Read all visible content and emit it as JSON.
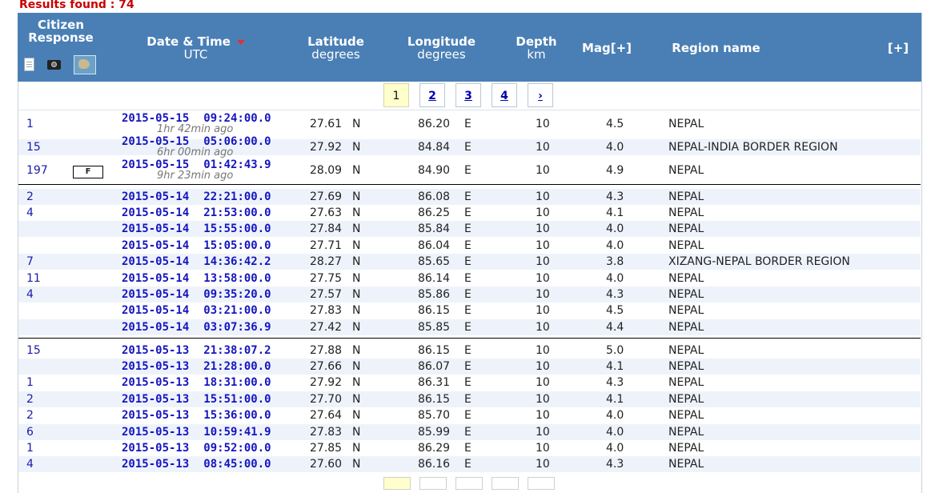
{
  "results_label": "Results found : 74",
  "header": {
    "citizen": "Citizen\nResponse",
    "date_title": "Date & Time",
    "date_sub": "UTC",
    "lat_title": "Latitude",
    "lat_sub": "degrees",
    "lon_title": "Longitude",
    "lon_sub": "degrees",
    "depth_title": "Depth",
    "depth_sub": "km",
    "mag": "Mag[+]",
    "region": "Region name",
    "expand": "[+]"
  },
  "pager": [
    "1",
    "2",
    "3",
    "4",
    "›"
  ],
  "rows": [
    {
      "cit": "1",
      "date": "2015-05-15",
      "time": "09:24:00.0",
      "ago": "1hr 42min ago",
      "lat": "27.61",
      "latd": "N",
      "lon": "86.20",
      "lond": "E",
      "depth": "10",
      "mag": "4.5",
      "region": "NEPAL"
    },
    {
      "cit": "15",
      "date": "2015-05-15",
      "time": "05:06:00.0",
      "ago": "6hr 00min ago",
      "lat": "27.92",
      "latd": "N",
      "lon": "84.84",
      "lond": "E",
      "depth": "10",
      "mag": "4.0",
      "region": "NEPAL-INDIA BORDER REGION"
    },
    {
      "cit": "197",
      "flag": "F",
      "date": "2015-05-15",
      "time": "01:42:43.9",
      "ago": "9hr 23min ago",
      "lat": "28.09",
      "latd": "N",
      "lon": "84.90",
      "lond": "E",
      "depth": "10",
      "mag": "4.9",
      "region": "NEPAL"
    },
    {
      "cit": "2",
      "date": "2015-05-14",
      "time": "22:21:00.0",
      "lat": "27.69",
      "latd": "N",
      "lon": "86.08",
      "lond": "E",
      "depth": "10",
      "mag": "4.3",
      "region": "NEPAL"
    },
    {
      "cit": "4",
      "date": "2015-05-14",
      "time": "21:53:00.0",
      "lat": "27.63",
      "latd": "N",
      "lon": "86.25",
      "lond": "E",
      "depth": "10",
      "mag": "4.1",
      "region": "NEPAL"
    },
    {
      "cit": "",
      "date": "2015-05-14",
      "time": "15:55:00.0",
      "lat": "27.84",
      "latd": "N",
      "lon": "85.84",
      "lond": "E",
      "depth": "10",
      "mag": "4.0",
      "region": "NEPAL"
    },
    {
      "cit": "",
      "date": "2015-05-14",
      "time": "15:05:00.0",
      "lat": "27.71",
      "latd": "N",
      "lon": "86.04",
      "lond": "E",
      "depth": "10",
      "mag": "4.0",
      "region": "NEPAL"
    },
    {
      "cit": "7",
      "date": "2015-05-14",
      "time": "14:36:42.2",
      "lat": "28.27",
      "latd": "N",
      "lon": "85.65",
      "lond": "E",
      "depth": "10",
      "mag": "3.8",
      "region": "XIZANG-NEPAL BORDER REGION"
    },
    {
      "cit": "11",
      "date": "2015-05-14",
      "time": "13:58:00.0",
      "lat": "27.75",
      "latd": "N",
      "lon": "86.14",
      "lond": "E",
      "depth": "10",
      "mag": "4.0",
      "region": "NEPAL"
    },
    {
      "cit": "4",
      "date": "2015-05-14",
      "time": "09:35:20.0",
      "lat": "27.57",
      "latd": "N",
      "lon": "85.86",
      "lond": "E",
      "depth": "10",
      "mag": "4.3",
      "region": "NEPAL"
    },
    {
      "cit": "",
      "date": "2015-05-14",
      "time": "03:21:00.0",
      "lat": "27.83",
      "latd": "N",
      "lon": "86.15",
      "lond": "E",
      "depth": "10",
      "mag": "4.5",
      "region": "NEPAL"
    },
    {
      "cit": "",
      "date": "2015-05-14",
      "time": "03:07:36.9",
      "lat": "27.42",
      "latd": "N",
      "lon": "85.85",
      "lond": "E",
      "depth": "10",
      "mag": "4.4",
      "region": "NEPAL"
    },
    {
      "cit": "15",
      "date": "2015-05-13",
      "time": "21:38:07.2",
      "lat": "27.88",
      "latd": "N",
      "lon": "86.15",
      "lond": "E",
      "depth": "10",
      "mag": "5.0",
      "region": "NEPAL"
    },
    {
      "cit": "",
      "date": "2015-05-13",
      "time": "21:28:00.0",
      "lat": "27.66",
      "latd": "N",
      "lon": "86.07",
      "lond": "E",
      "depth": "10",
      "mag": "4.1",
      "region": "NEPAL"
    },
    {
      "cit": "1",
      "date": "2015-05-13",
      "time": "18:31:00.0",
      "lat": "27.92",
      "latd": "N",
      "lon": "86.31",
      "lond": "E",
      "depth": "10",
      "mag": "4.3",
      "region": "NEPAL"
    },
    {
      "cit": "2",
      "date": "2015-05-13",
      "time": "15:51:00.0",
      "lat": "27.70",
      "latd": "N",
      "lon": "86.15",
      "lond": "E",
      "depth": "10",
      "mag": "4.1",
      "region": "NEPAL"
    },
    {
      "cit": "2",
      "date": "2015-05-13",
      "time": "15:36:00.0",
      "lat": "27.64",
      "latd": "N",
      "lon": "85.70",
      "lond": "E",
      "depth": "10",
      "mag": "4.0",
      "region": "NEPAL"
    },
    {
      "cit": "6",
      "date": "2015-05-13",
      "time": "10:59:41.9",
      "lat": "27.83",
      "latd": "N",
      "lon": "85.99",
      "lond": "E",
      "depth": "10",
      "mag": "4.0",
      "region": "NEPAL"
    },
    {
      "cit": "1",
      "date": "2015-05-13",
      "time": "09:52:00.0",
      "lat": "27.85",
      "latd": "N",
      "lon": "86.29",
      "lond": "E",
      "depth": "10",
      "mag": "4.0",
      "region": "NEPAL"
    },
    {
      "cit": "4",
      "date": "2015-05-13",
      "time": "08:45:00.0",
      "lat": "27.60",
      "latd": "N",
      "lon": "86.16",
      "lond": "E",
      "depth": "10",
      "mag": "4.3",
      "region": "NEPAL"
    }
  ]
}
